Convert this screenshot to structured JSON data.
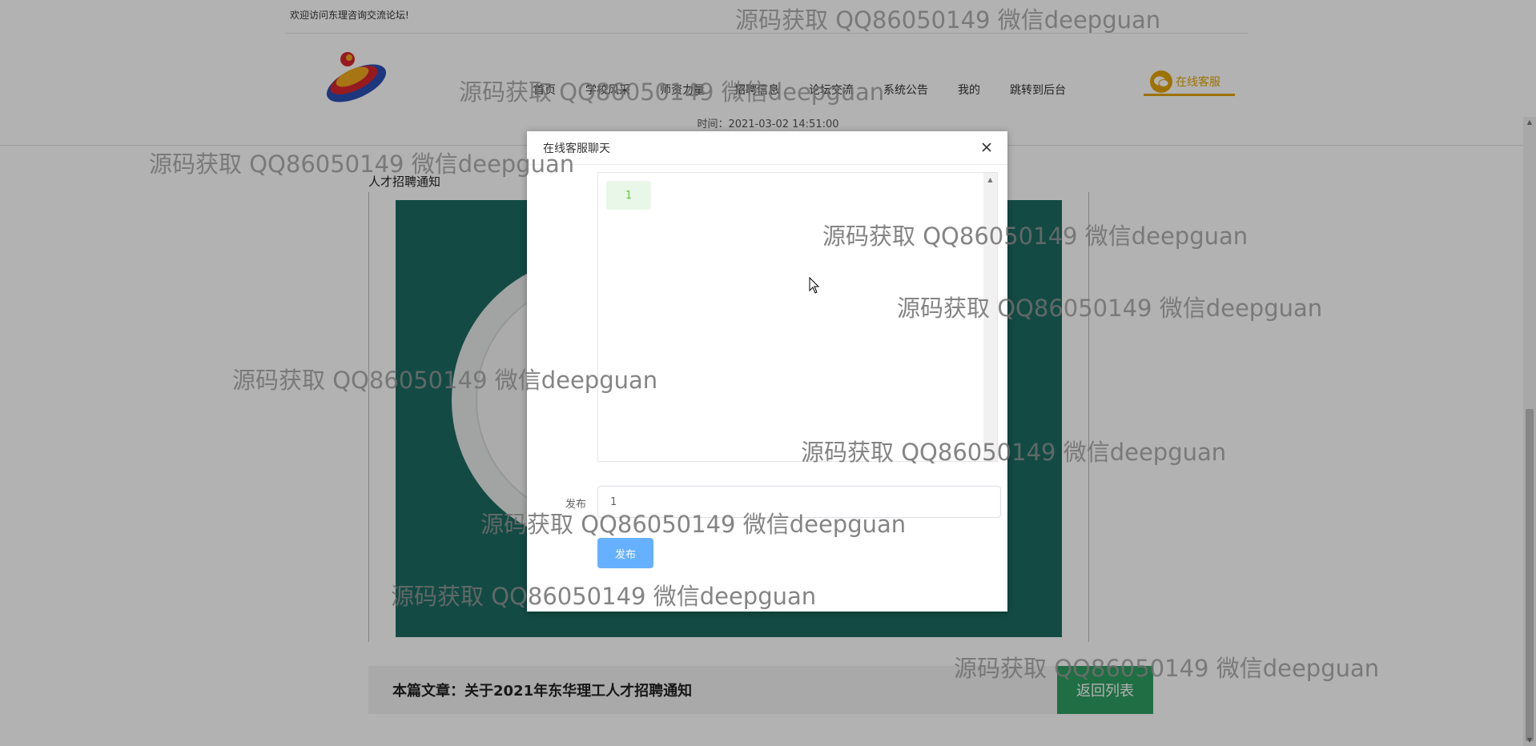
{
  "topbar": {
    "welcome": "欢迎访问东理咨询交流论坛!"
  },
  "nav": {
    "items": [
      "首页",
      "学校风采",
      "师资力量",
      "招聘信息",
      "论坛交流",
      "系统公告",
      "我的",
      "跳转到后台"
    ],
    "service_label": "在线客服"
  },
  "header": {
    "time": "时间：2021-03-02 14:51:00"
  },
  "article": {
    "section_label": "人才招聘通知",
    "bar_title": "本篇文章：关于2021年东华理工人才招聘通知",
    "back_label": "返回列表"
  },
  "modal": {
    "title": "在线客服聊天",
    "messages": [
      "1"
    ],
    "form_label": "发布",
    "input_value": "1",
    "submit_label": "发布"
  },
  "watermark": {
    "text": "源码获取 QQ86050149 微信deepguan"
  },
  "colors": {
    "accent_gold": "#e2a400",
    "back_button": "#2e9e62",
    "submit_button": "#66b1ff",
    "poster_bg": "#1c6b62"
  }
}
